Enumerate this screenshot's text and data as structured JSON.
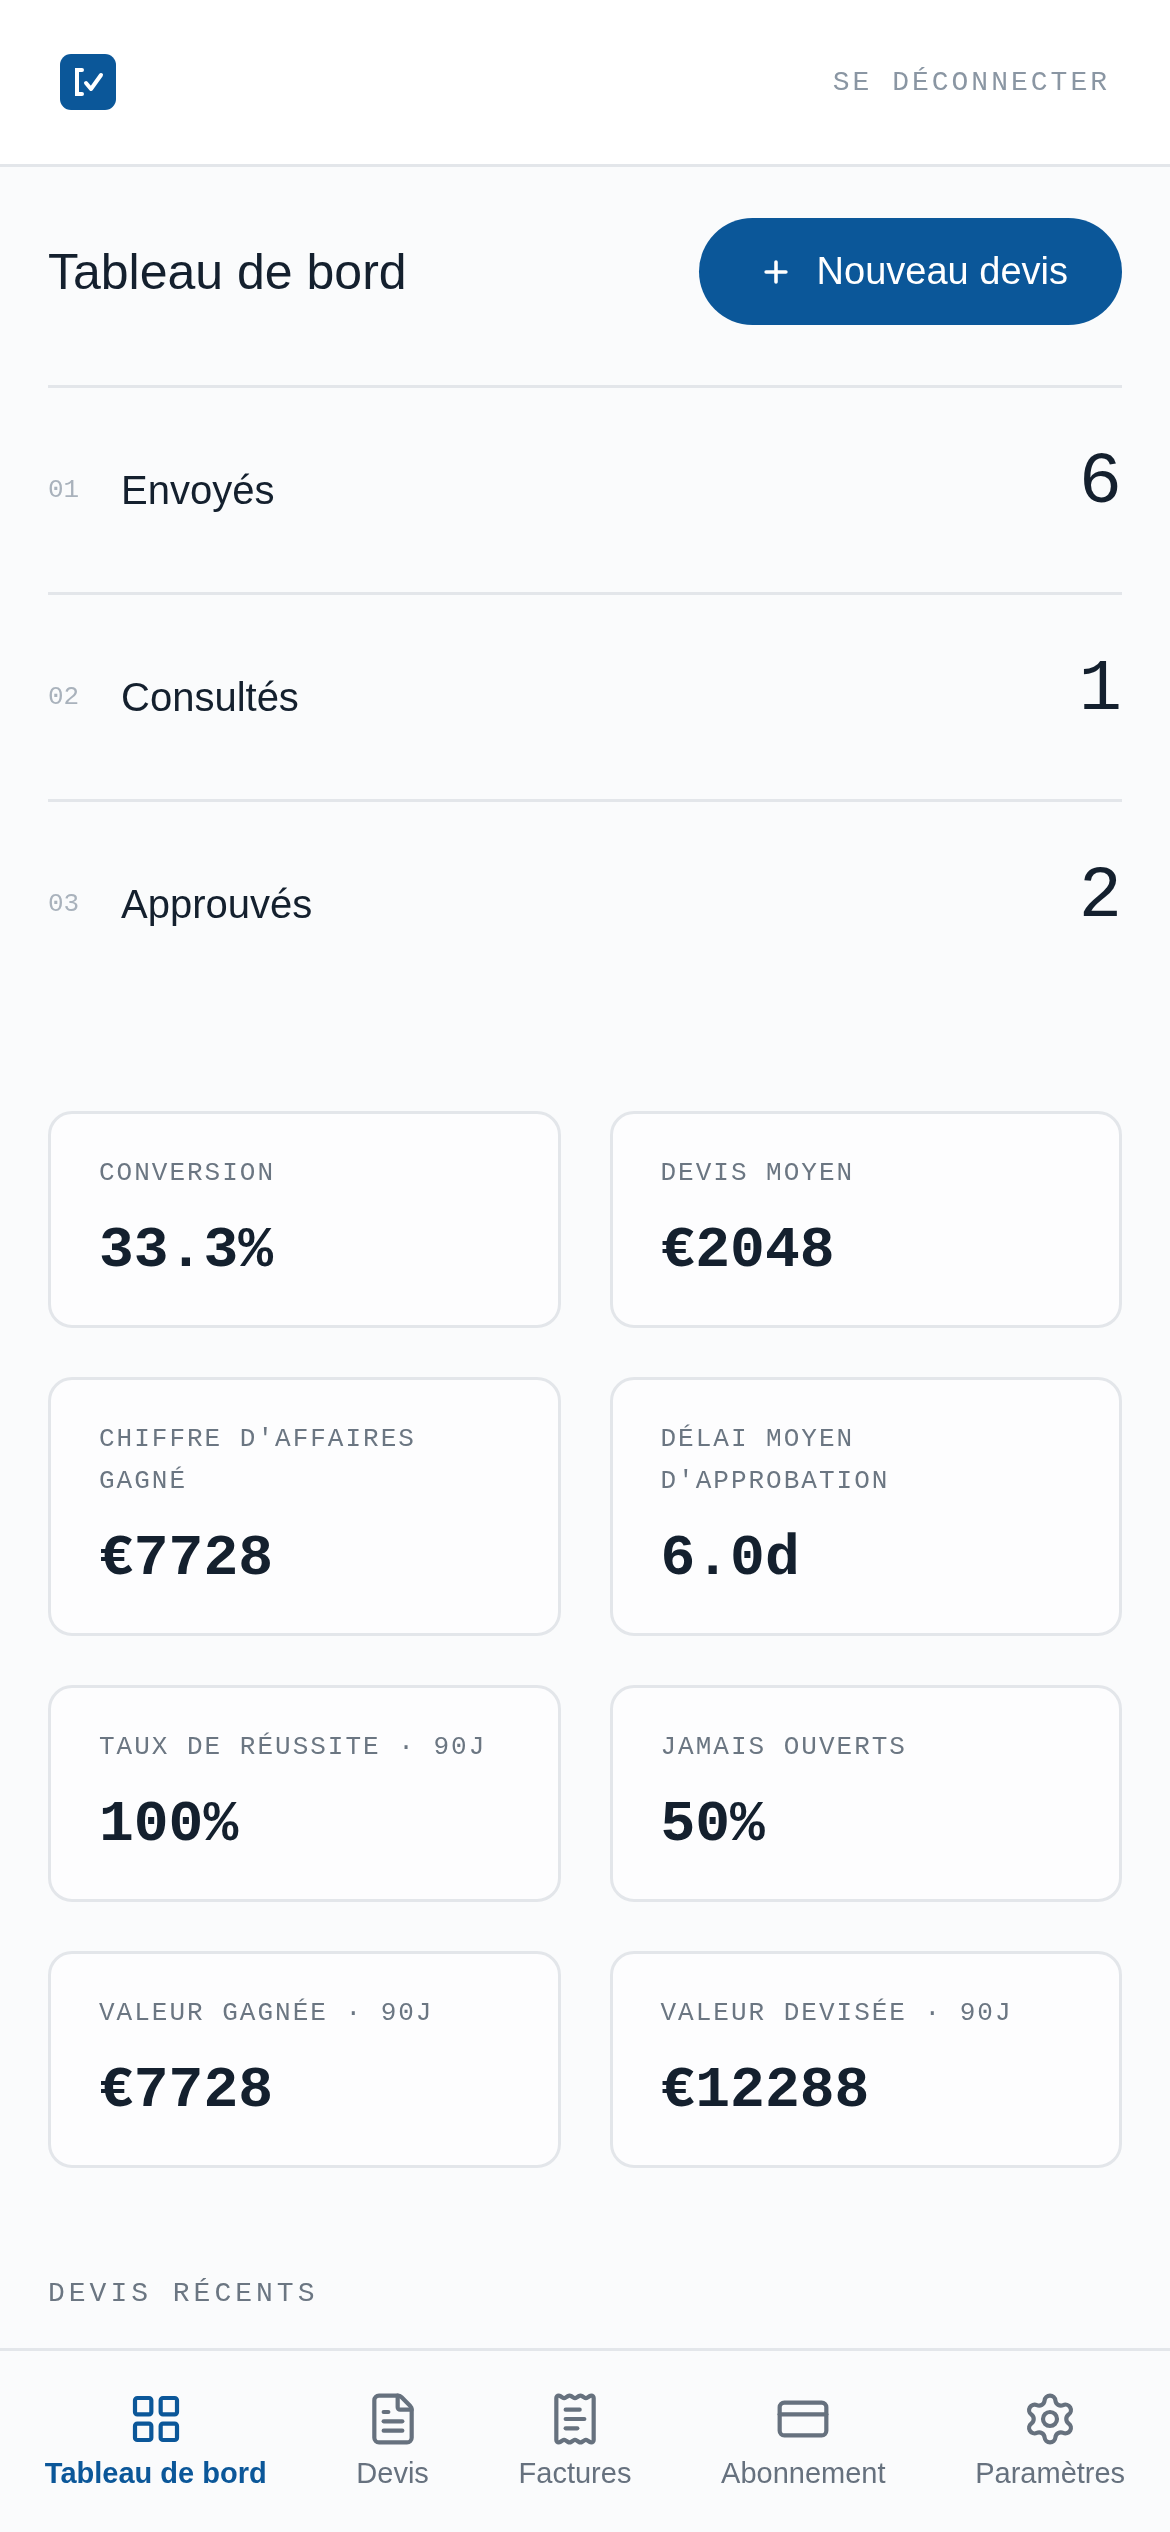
{
  "header": {
    "logout": "SE DÉCONNECTER"
  },
  "page": {
    "title": "Tableau de bord",
    "new_button": "Nouveau devis"
  },
  "pipeline": [
    {
      "index": "01",
      "label": "Envoyés",
      "count": "6"
    },
    {
      "index": "02",
      "label": "Consultés",
      "count": "1"
    },
    {
      "index": "03",
      "label": "Approuvés",
      "count": "2"
    }
  ],
  "metrics": [
    {
      "label": "CONVERSION",
      "value": "33.3%"
    },
    {
      "label": "DEVIS MOYEN",
      "value": "€2048"
    },
    {
      "label": "CHIFFRE D'AFFAIRES GAGNÉ",
      "value": "€7728"
    },
    {
      "label": "DÉLAI MOYEN D'APPROBATION",
      "value": "6.0d"
    },
    {
      "label": "TAUX DE RÉUSSITE · 90J",
      "value": "100%"
    },
    {
      "label": "JAMAIS OUVERTS",
      "value": "50%"
    },
    {
      "label": "VALEUR GAGNÉE · 90J",
      "value": "€7728"
    },
    {
      "label": "VALEUR DEVISÉE · 90J",
      "value": "€12288"
    }
  ],
  "recent_heading": "DEVIS RÉCENTS",
  "nav": [
    {
      "kind": "grid",
      "label": "Tableau de bord",
      "selected": true
    },
    {
      "kind": "file",
      "label": "Devis",
      "selected": false
    },
    {
      "kind": "receipt",
      "label": "Factures",
      "selected": false
    },
    {
      "kind": "card",
      "label": "Abonnement",
      "selected": false
    },
    {
      "kind": "gear",
      "label": "Paramètres",
      "selected": false
    }
  ]
}
